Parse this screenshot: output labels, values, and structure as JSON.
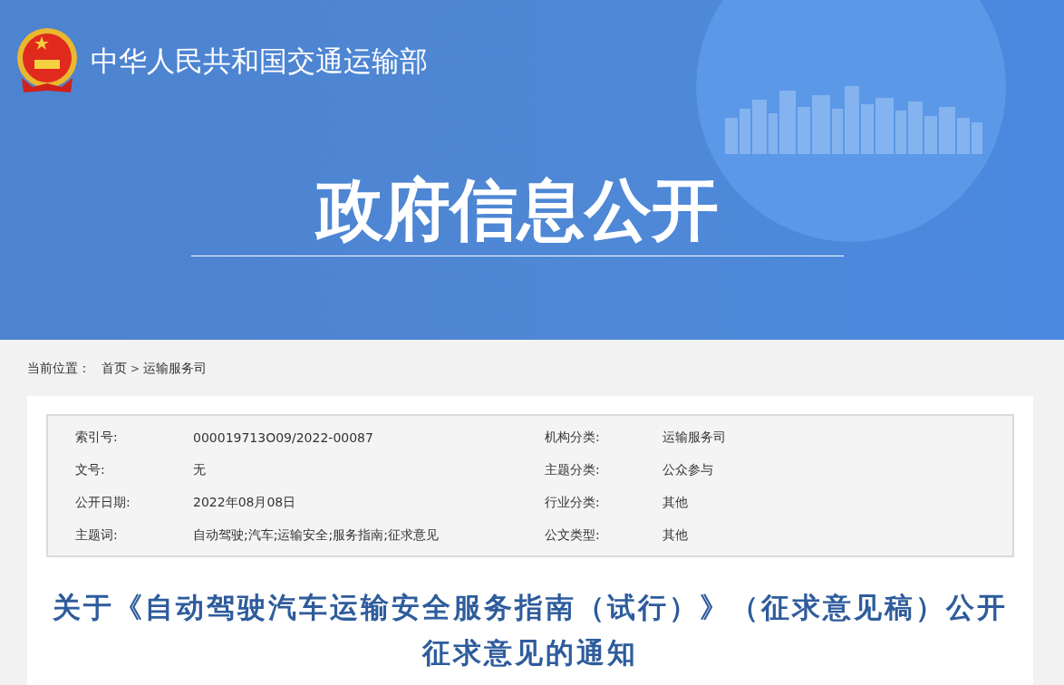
{
  "header": {
    "ministry": "中华人民共和国交通运输部",
    "banner_title": "政府信息公开"
  },
  "breadcrumb": {
    "label": "当前位置：",
    "items": [
      {
        "text": "首页",
        "kind": "link"
      },
      {
        "text": ">",
        "kind": "separator"
      },
      {
        "text": "运输服务司",
        "kind": "link"
      }
    ]
  },
  "metadata": [
    {
      "label": "索引号:",
      "value": "000019713O09/2022-00087",
      "label_2": "机构分类:",
      "value_2": "运输服务司"
    },
    {
      "label": "文号:",
      "value": "无",
      "label_2": "主题分类:",
      "value_2": "公众参与"
    },
    {
      "label": "公开日期:",
      "value": "2022年08月08日",
      "label_2": "行业分类:",
      "value_2": "其他"
    },
    {
      "label": "主题词:",
      "value": "自动驾驶;汽车;运输安全;服务指南;征求意见",
      "label_2": "公文类型:",
      "value_2": "其他"
    }
  ],
  "article": {
    "title": "关于《自动驾驶汽车运输安全服务指南（试行）》（征求意见稿）公开征求意见的通知"
  }
}
